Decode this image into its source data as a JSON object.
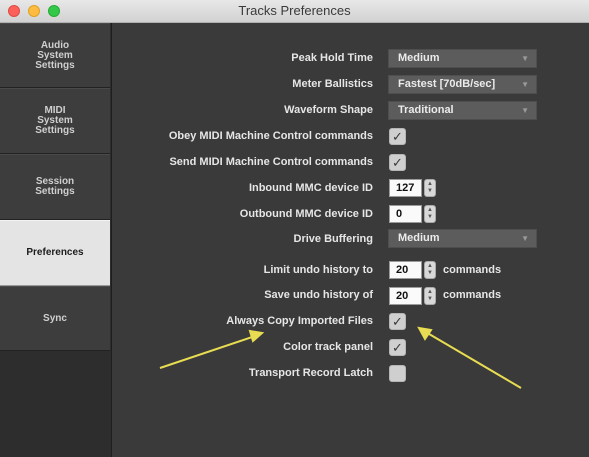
{
  "window": {
    "title": "Tracks Preferences"
  },
  "sidebar": {
    "items": [
      {
        "label": "Audio\nSystem\nSettings"
      },
      {
        "label": "MIDI\nSystem\nSettings"
      },
      {
        "label": "Session\nSettings"
      },
      {
        "label": "Preferences"
      },
      {
        "label": "Sync"
      }
    ],
    "active": "Preferences"
  },
  "prefs": {
    "peak_hold": {
      "label": "Peak Hold Time",
      "value": "Medium"
    },
    "meter_ballistics": {
      "label": "Meter Ballistics",
      "value": "Fastest [70dB/sec]"
    },
    "waveform_shape": {
      "label": "Waveform Shape",
      "value": "Traditional"
    },
    "obey_mmc": {
      "label": "Obey MIDI Machine Control commands",
      "checked": true
    },
    "send_mmc": {
      "label": "Send MIDI Machine Control commands",
      "checked": true
    },
    "inbound_mmc": {
      "label": "Inbound MMC device ID",
      "value": "127"
    },
    "outbound_mmc": {
      "label": "Outbound MMC device ID",
      "value": "0"
    },
    "drive_buffering": {
      "label": "Drive Buffering",
      "value": "Medium"
    },
    "limit_undo": {
      "label": "Limit undo history to",
      "value": "20",
      "suffix": "commands"
    },
    "save_undo": {
      "label": "Save undo history of",
      "value": "20",
      "suffix": "commands"
    },
    "always_copy": {
      "label": "Always Copy Imported Files",
      "checked": true
    },
    "color_track_panel": {
      "label": "Color track panel",
      "checked": true
    },
    "transport_record_latch": {
      "label": "Transport Record Latch",
      "checked": false
    }
  },
  "annotation": {
    "arrow_color": "#e8dc52"
  }
}
